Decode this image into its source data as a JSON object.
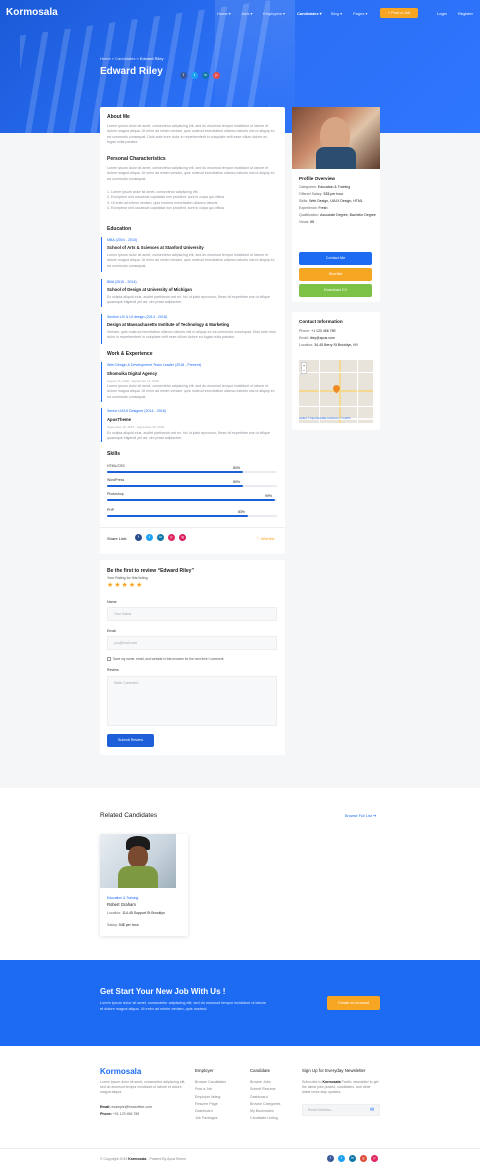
{
  "brand": "Kormosala",
  "nav": {
    "home": "Home ▾",
    "jobs": "Jobs ▾",
    "employers": "Employers ▾",
    "candidates": "Candidates ▾",
    "blog": "Blog ▾",
    "pages": "Pages ▾",
    "post_job": "+ Post a Job",
    "login": "Login",
    "register": "Register"
  },
  "breadcrumb": {
    "home": "Home",
    "candidates": "Candidates",
    "current": "Edward Riley",
    "sep": "»"
  },
  "candidate": {
    "name": "Edward Riley"
  },
  "about": {
    "title": "About Me",
    "p1": "Lorem ipsum dolor sit amet, consectetur adipiscing elit, sed do eiusmod tempor incididunt ut labore et dolore magna aliqua. Ut enim ad minim veniam, quis nostrud exercitation ullamco laboris nisi ut aliquip ex ea commodo consequat. Duis aute irure dolor in reprehenderit in voluptate velit esse cillum dolore eu fugiat nulla pariatur.",
    "pc_title": "Personal Characteristics",
    "p2": "Lorem ipsum dolor sit amet, consectetur adipiscing elit, sed do eiusmod tempor incididunt ut labore et dolore magna aliqua. Ut enim ad minim veniam, quis nostrud exercitation ullamco laboris nisi ut aliquip ex ea commodo consequat.",
    "list": [
      "1. Lorem ipsum dolor sit amet, consectetur adipiscing elit",
      "2. Excepteur sint occaecat cupidatat non proident, sunt in culpa qui officia",
      "3. Ut enim ad minim veniam, quis nostrud exercitation ullamco laboris",
      "4. Excepteur sint occaecat cupidatat non proident, sunt in culpa qui officia"
    ]
  },
  "education": {
    "title": "Education",
    "items": [
      {
        "tag": "MBA (2004 - 2010)",
        "school": "School of Arts & Sciences at Stanford University",
        "text": "Lorem ipsum dolor sit amet, consectetur adipiscing elit, sed do eiusmod tempor incididunt ut labore et dolore magna aliqua. Ut enim ad minim veniam, quis nostrud exercitation ullamco laboris nisi ut aliquip ex ea commodo consequat."
      },
      {
        "tag": "BBA (2010 - 2014)",
        "school": "School of Design at University of Michigan",
        "text": "Ex sciipta aliquid eius, audiet parthendo est ex, hui ut justo epicuruei; Nean vit expertiam eos ut ellique quaesque eligendi yet ad, vim prata adipiscere."
      },
      {
        "tag": "Section UX & UI design (2014 - 2018)",
        "school": "Design at Massachusetts Institute of Technology & Marketing",
        "text": "Veniam, quis nostrud exercitation ullamco laboris nisi ut aliquip ex ea commodo consequat. Duis aute irure dolor in reprehenderit in voluptate velit esse cillum dolore eu fugiat nulla pariatur."
      }
    ]
  },
  "work": {
    "title": "Work & Experience",
    "items": [
      {
        "tag": "Web Design & Development Team Leader (2018 - Present)",
        "company": "Shomoika Digital Agency",
        "date": "August 15, 2018 - September 19, 2019",
        "text": "Lorem ipsum dolor sit amet, consectetur adipiscing elit, sed do eiusmod tempor incididunt ut labore et dolore magna aliqua. Ut enim ad minim veniam, quis nostrud exercitation ullamco laboris nisi ut aliquip ex ea commodo consequat."
      },
      {
        "tag": "Senior UX/UI Designer (2014 - 2018)",
        "company": "ApusTheme",
        "date": "September 19, 2019 - September 20, 2019",
        "text": "Ex sciipta aliquid eius, audiet parthendo est ex, hui ut justo epicuruei; Nean vit expertiam eos ut ellique quaesque eligendi yet ad, vim prata adipiscere."
      }
    ]
  },
  "skills": {
    "title": "Skills",
    "items": [
      {
        "name": "HTML/CSS",
        "value": "80%",
        "fraction": 0.8
      },
      {
        "name": "WordPress",
        "value": "80%",
        "fraction": 0.8
      },
      {
        "name": "Photoshop",
        "value": "99%",
        "fraction": 0.99
      },
      {
        "name": "PHP",
        "value": "83%",
        "fraction": 0.83
      }
    ]
  },
  "share": {
    "label": "Share Link:",
    "wishlist": "♡  Wishlist"
  },
  "review": {
    "title": "Be the first to review “Edward Riley”",
    "rating_label": "Your Rating for this listing",
    "stars": "★★★★★",
    "name_label": "Name",
    "name_ph": "Your Name",
    "email_label": "Email",
    "email_ph": "you@mail.com",
    "save": "Save my name, email, and website in this browser for the next time I comment.",
    "review_label": "Review",
    "review_ph": "Write Comment",
    "submit": "Submit Review"
  },
  "overview": {
    "title": "Profile Overview",
    "rows": [
      {
        "k": "Categories:",
        "v": "Education & Training"
      },
      {
        "k": "Offered Salary:",
        "v": "53$ per hour"
      },
      {
        "k": "Skills:",
        "v": "Web Design, UI/UX Design, HTML"
      },
      {
        "k": "Experience:",
        "v": "Fresh"
      },
      {
        "k": "Qualification:",
        "v": "Associate Degree, Bachelor Degree"
      },
      {
        "k": "Views:",
        "v": "68"
      }
    ],
    "contact_btn": "Contact Me",
    "shortlist_btn": "Shortlist",
    "download_btn": "Download CV"
  },
  "contact": {
    "title": "Contact Information",
    "phone_k": "Phone:",
    "phone": "+1 123 456 789",
    "email_k": "Email:",
    "email": "riley@apus.com",
    "loc_k": "Location:",
    "loc": "34-45 Berry St Brooklyn, NY",
    "map_credit": "Leaflet | © OpenStreetMap contributors, © CARTO"
  },
  "related": {
    "title": "Related Candidates",
    "browse": "Browse Full List  ➜",
    "card": {
      "category": "Education & Training",
      "name": "Robert Graham",
      "loc_k": "Location:",
      "loc": "114-45 Support St Brooklyn",
      "sal_k": "Salary:",
      "sal": "54$ per hour"
    }
  },
  "cta": {
    "title": "Get Start Your New Job With Us !",
    "text": "Lorem ipsum dolor sit amet, consectetur adipiscing elit, sed do eiusmod tempor incididunt ut labore et dolore magna aliqua. Ut enim ad minim veniam, quis nostrud.",
    "btn": "Create an Account"
  },
  "footer": {
    "brand": "Kormosala",
    "about": "Lorem ipsum dolor sit amet, consectetur adipiscing elit, sed do eiusmod tempor incididunt ut labore et dolore magna aliqua.",
    "email_k": "Email:",
    "email": "example@headoffice.com",
    "phone_k": "Phone:",
    "phone": "+01 123 456 789",
    "col1": {
      "title": "Employer",
      "links": [
        "Browse Candidates",
        "Post a Job",
        "Employer listing",
        "Resume Page",
        "Dashboard",
        "Job Packages"
      ]
    },
    "col2": {
      "title": "Candidate",
      "links": [
        "Browse Jobs",
        "Submit Resume",
        "Dashboard",
        "Browse Categories",
        "My Bookmarks",
        "Candidate Listing"
      ]
    },
    "news": {
      "title": "Sign Up for Everyday Newsletter",
      "text_pre": "Subscribe to ",
      "text_brand": "Kormosala",
      "text_post": " Pacific newsletter to get the latest jobs posted, candidates, and other latest news stay updates.",
      "ph": "Email Address..."
    },
    "copy_pre": "© Copyright 2019 ",
    "copy_brand": "Kormosala",
    "copy_post": " - Powerd By ApusTheme"
  },
  "colors": {
    "blue": "#1c6bf2",
    "orange": "#f7a623",
    "green": "#7cc246",
    "red": "#e54d4d"
  }
}
